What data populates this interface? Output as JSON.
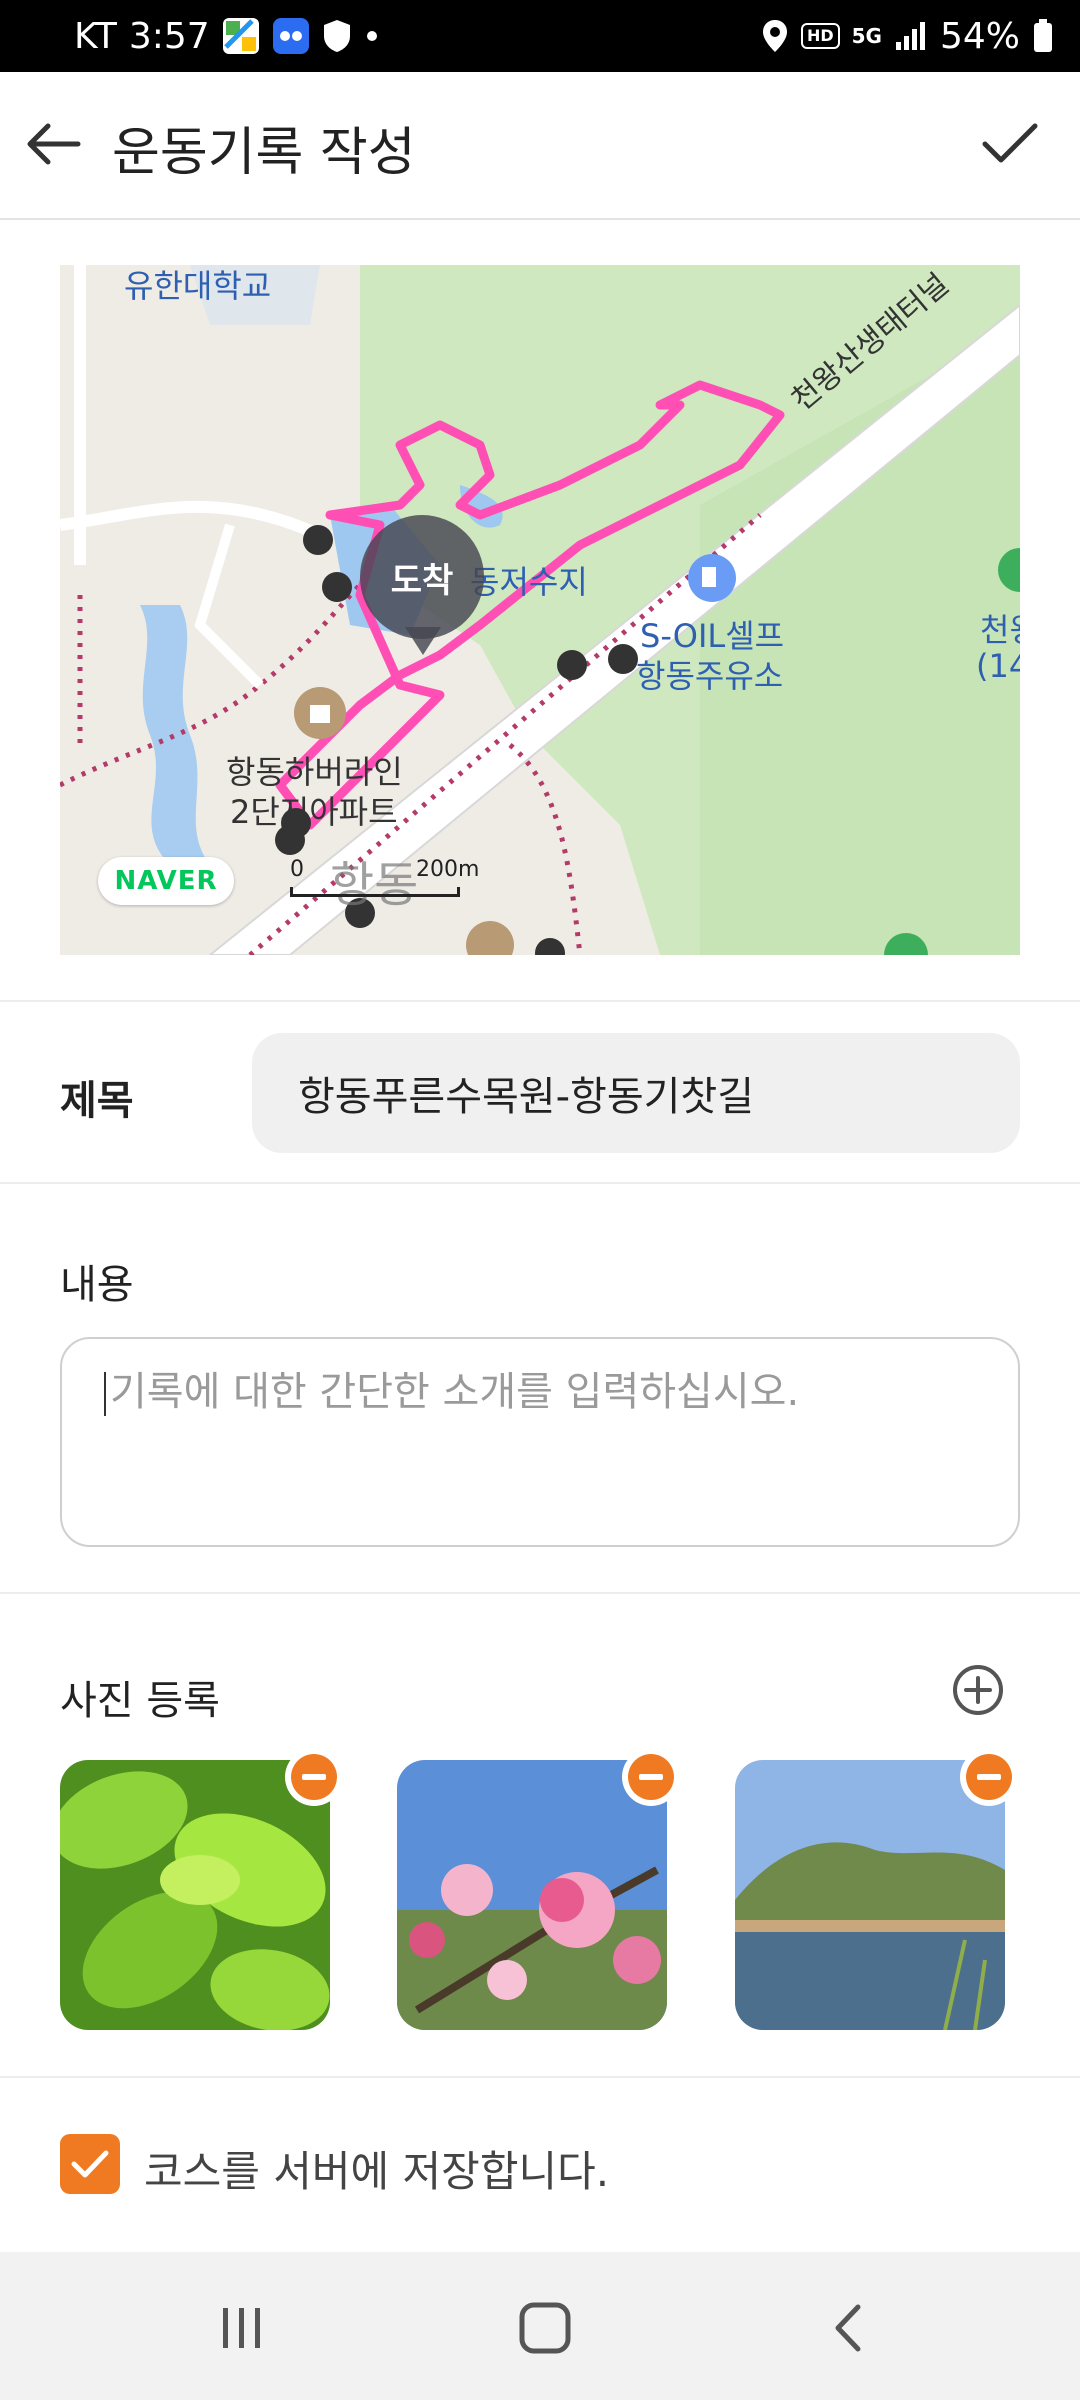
{
  "status_bar": {
    "carrier": "KT",
    "time": "3:57",
    "hd_label": "HD",
    "network": "5G",
    "battery": "54%"
  },
  "header": {
    "title": "운동기록 작성"
  },
  "map": {
    "labels": {
      "university": "유한대학교",
      "tunnel": "천왕산생태터널",
      "reservoir": "동저수지",
      "gas_station_line1": "S-OIL셀프",
      "gas_station_line2": "항동주유소",
      "apartment_line1": "항동하버라인",
      "apartment_line2": "2단지아파트",
      "district": "항동",
      "right_edge_line1": "천왕",
      "right_edge_line2": "(14"
    },
    "arrival_marker": "도착",
    "provider": "NAVER",
    "scale_zero": "0",
    "scale_distance": "200m"
  },
  "form": {
    "title_label": "제목",
    "title_value": "항동푸른수목원-항동기찻길",
    "content_label": "내용",
    "content_placeholder": "기록에 대한 간단한 소개를 입력하십시오.",
    "photo_section_label": "사진 등록",
    "photos": [
      {
        "subject": "green leaves"
      },
      {
        "subject": "pink blossoms"
      },
      {
        "subject": "lake with hills"
      }
    ],
    "save_course_checked": true,
    "save_course_label": "코스를 서버에 저장합니다."
  },
  "colors": {
    "accent": "#f07a22",
    "route": "#ff4fb4",
    "naver_green": "#03c75a"
  }
}
